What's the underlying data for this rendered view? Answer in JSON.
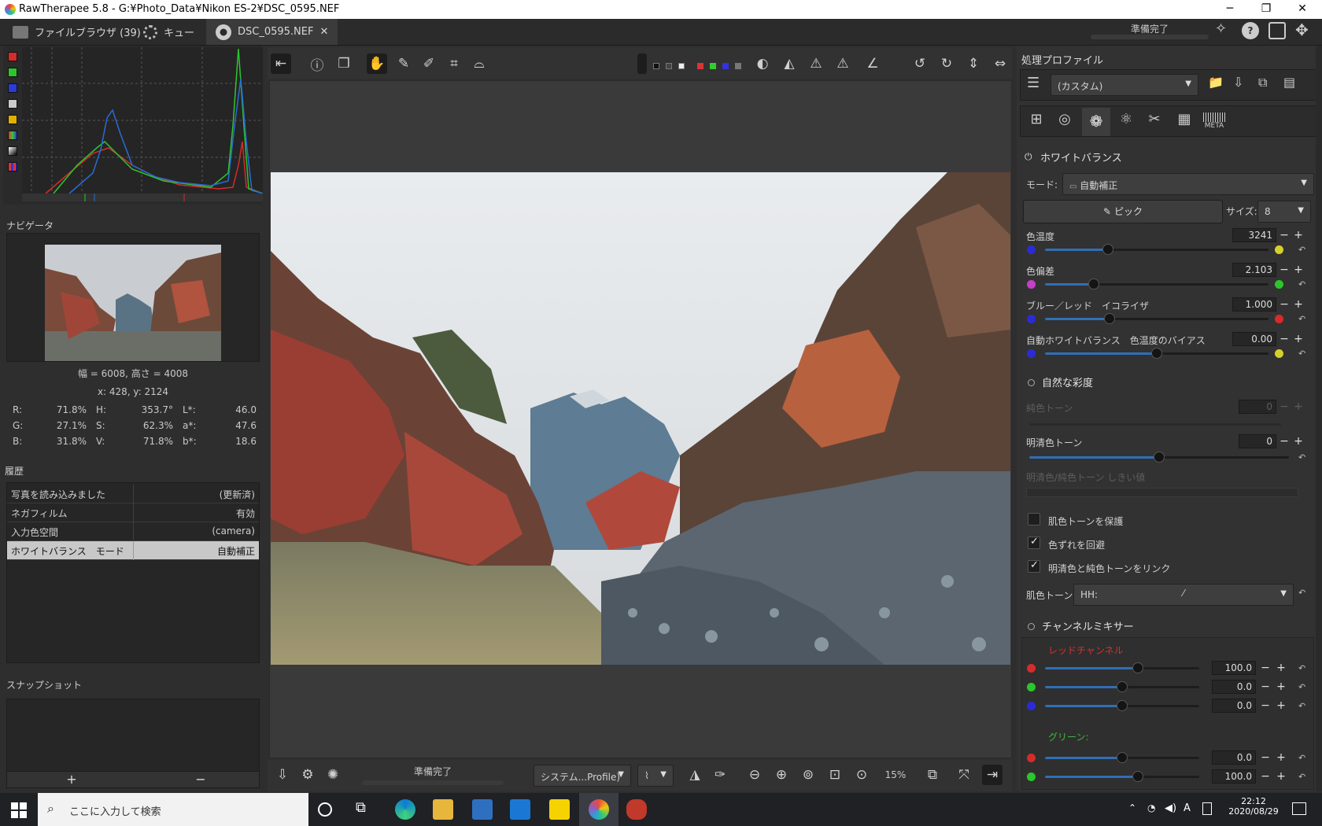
{
  "window": {
    "title": "RawTherapee 5.8 - G:¥Photo_Data¥Nikon ES-2¥DSC_0595.NEF"
  },
  "tabs": {
    "file_browser": "ファイルブラウザ (39)",
    "queue": "キュー",
    "editor": "DSC_0595.NEF",
    "close": "✕"
  },
  "status_top": "準備完了",
  "navigator": {
    "title": "ナビゲータ",
    "size": "幅 = 6008, 高さ = 4008",
    "coords": "x: 428, y: 2124",
    "rows": [
      {
        "l1": "R:",
        "v1": "71.8%",
        "l2": "H:",
        "v2": "353.7°",
        "l3": "L*:",
        "v3": "46.0"
      },
      {
        "l1": "G:",
        "v1": "27.1%",
        "l2": "S:",
        "v2": "62.3%",
        "l3": "a*:",
        "v3": "47.6"
      },
      {
        "l1": "B:",
        "v1": "31.8%",
        "l2": "V:",
        "v2": "71.8%",
        "l3": "b*:",
        "v3": "18.6"
      }
    ]
  },
  "history": {
    "title": "履歴",
    "rows": [
      {
        "label": "写真を読み込みました",
        "value": "(更新済)"
      },
      {
        "label": "ネガフィルム",
        "value": "有効"
      },
      {
        "label": "入力色空間",
        "value": "(camera)"
      },
      {
        "label": "ホワイトバランス　モード",
        "value": "自動補正"
      }
    ]
  },
  "snapshot": {
    "title": "スナップショット",
    "add": "+",
    "remove": "−"
  },
  "bottombar": {
    "status": "準備完了",
    "profile": "システム...Profile)",
    "zoom": "15%"
  },
  "right_panel": {
    "profile_title": "処理プロファイル",
    "profile_value": "(カスタム)",
    "meta_tab": "META",
    "white_balance": {
      "title": "ホワイトバランス",
      "mode_label": "モード:",
      "mode_value": "自動補正",
      "pick_label": "ピック",
      "size_label": "サイズ:",
      "size_value": "8",
      "sliders": [
        {
          "label": "色温度",
          "value": "3241",
          "pos": 0.28,
          "left_color": "#2b2bd6",
          "right_color": "#d6d02b"
        },
        {
          "label": "色偏差",
          "value": "2.103",
          "pos": 0.22,
          "left_color": "#c63fc6",
          "right_color": "#2bc62b"
        },
        {
          "label": "ブルー／レッド　イコライザ",
          "value": "1.000",
          "pos": 0.29,
          "left_color": "#2b2bd6",
          "right_color": "#d62b2b"
        },
        {
          "label": "自動ホワイトバランス　色温度のバイアス",
          "value": "0.00",
          "pos": 0.5,
          "left_color": "#2b2bd6",
          "right_color": "#d6d02b"
        }
      ]
    },
    "vibrance": {
      "title": "自然な彩度",
      "pastel_label": "純色トーン",
      "pastel_value": "0",
      "saturated_label": "明清色トーン",
      "saturated_value": "0",
      "threshold_label": "明清色/純色トーン しきい値",
      "protect_skin": "肌色トーンを保護",
      "avoid_shift": "色ずれを回避",
      "link": "明清色と純色トーンをリンク",
      "skin_label": "肌色トーン:",
      "skin_value": "HH:"
    },
    "channel_mixer": {
      "title": "チャンネルミキサー",
      "red_label": "レッドチャンネル",
      "green_label": "グリーン:",
      "red_values": [
        "100.0",
        "0.0",
        "0.0"
      ],
      "green_values": [
        "0.0",
        "100.0"
      ],
      "red_colors": [
        "#d62b2b",
        "#2bc62b",
        "#2b2bd6"
      ],
      "green_colors": [
        "#d62b2b",
        "#2bc62b"
      ],
      "red_pos": [
        0.6,
        0.5,
        0.5
      ],
      "green_pos": [
        0.5,
        0.6
      ]
    }
  },
  "taskbar": {
    "search_placeholder": "ここに入力して検索",
    "time": "22:12",
    "date": "2020/08/29",
    "ime": "A"
  }
}
